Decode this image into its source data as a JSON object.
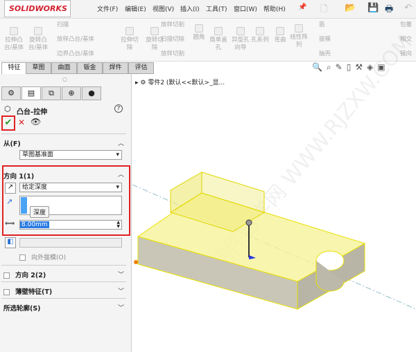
{
  "app": {
    "logo": "SOLIDWORKS"
  },
  "menu": [
    "文件(F)",
    "编辑(E)",
    "视图(V)",
    "插入(I)",
    "工具(T)",
    "窗口(W)",
    "帮助(H)"
  ],
  "ribbon": [
    {
      "label": "拉伸凸\n台/基体"
    },
    {
      "label": "旋转凸\n台/基体"
    },
    {
      "label": "扫描"
    },
    {
      "label": "放样凸台/基体"
    },
    {
      "label": "边界凸台/基体"
    },
    {
      "label": "拉伸切\n除"
    },
    {
      "label": "旋转切\n除"
    },
    {
      "label": "放样切割"
    },
    {
      "label": "扫描切除"
    },
    {
      "label": "放样切割"
    },
    {
      "label": "圆角"
    },
    {
      "label": "简单直\n孔"
    },
    {
      "label": "异型孔\n向导"
    },
    {
      "label": "孔系列"
    },
    {
      "label": "弯曲"
    },
    {
      "label": "线性阵\n列"
    },
    {
      "label": "筋"
    },
    {
      "label": "拔模"
    },
    {
      "label": "抽壳"
    },
    {
      "label": "包覆"
    },
    {
      "label": "相交"
    },
    {
      "label": "镜向"
    }
  ],
  "tabs": [
    "特征",
    "草图",
    "曲面",
    "钣金",
    "焊件",
    "评估"
  ],
  "tree": {
    "item": "零件2 (默认<<默认>_显..."
  },
  "panel": {
    "title": "凸台-拉伸",
    "from": {
      "label": "从(F)",
      "value": "草图基准面"
    },
    "dir1": {
      "label": "方向 1(1)",
      "end_condition": "给定深度",
      "tooltip": "深度",
      "depth": "8.00mm"
    },
    "draft_outward": "向外拔模(O)",
    "dir2": "方向 2(2)",
    "thin": "薄壁特征(T)",
    "contours": "所选轮廓(S)"
  },
  "watermark": "软件自学网 WWW.RJZXW.COM",
  "colors": {
    "highlight": "#e02020",
    "model": "#f4f08a",
    "accent": "#3399ff"
  }
}
